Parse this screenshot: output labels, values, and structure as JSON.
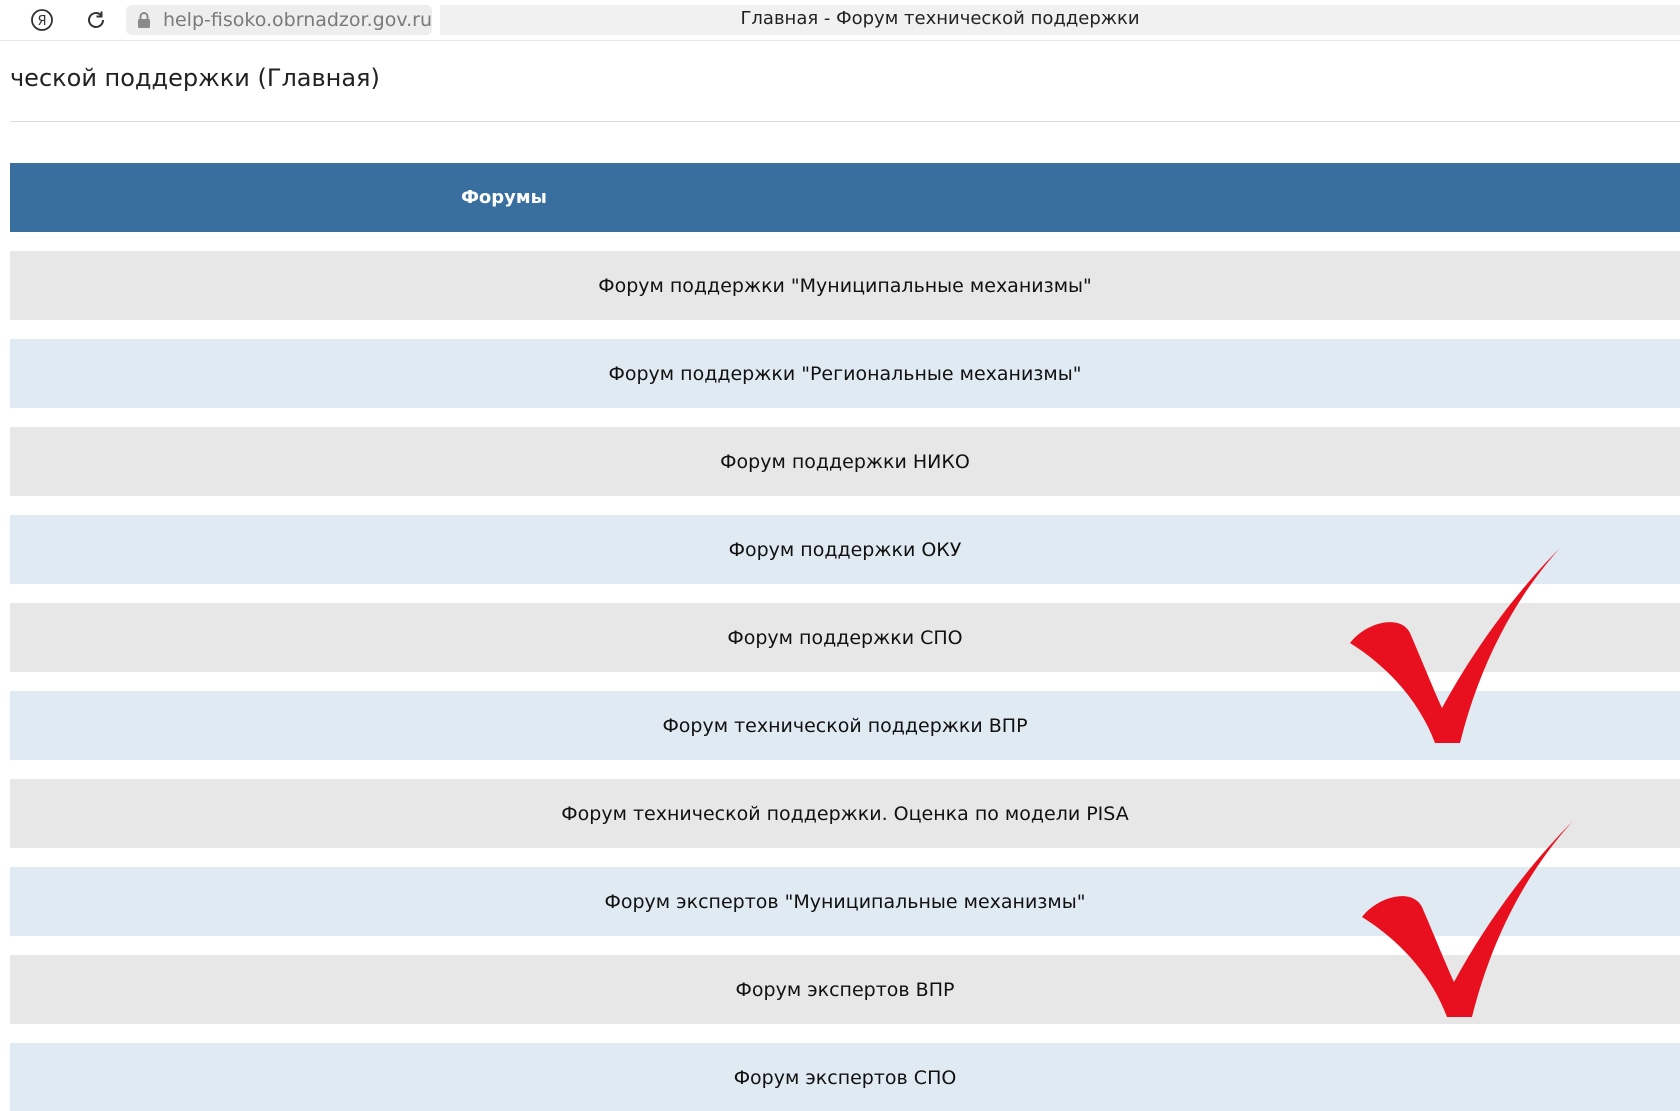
{
  "browser": {
    "url": "help-fisoko.obrnadzor.gov.ru",
    "tab_title": "Главная - Форум технической поддержки"
  },
  "page": {
    "heading": "ческой поддержки (Главная)"
  },
  "table": {
    "header": "Форумы",
    "rows": [
      {
        "label": "Форум поддержки \"Муниципальные механизмы\""
      },
      {
        "label": "Форум поддержки \"Региональные механизмы\""
      },
      {
        "label": "Форум поддержки НИКО"
      },
      {
        "label": "Форум поддержки ОКУ"
      },
      {
        "label": "Форум поддержки СПО"
      },
      {
        "label": "Форум технической поддержки ВПР"
      },
      {
        "label": "Форум технической поддержки. Оценка по модели PISA"
      },
      {
        "label": "Форум экспертов \"Муниципальные механизмы\""
      },
      {
        "label": "Форум экспертов ВПР"
      },
      {
        "label": "Форум экспертов СПО"
      }
    ]
  },
  "colors": {
    "header_bg": "#386f9e",
    "row_gray": "#e7e7e7",
    "row_blue": "#e0eaf3",
    "checkmark": "#e8101e"
  },
  "icons": [
    "yandex-icon",
    "reload-icon",
    "lock-icon",
    "checkmark-icon"
  ]
}
